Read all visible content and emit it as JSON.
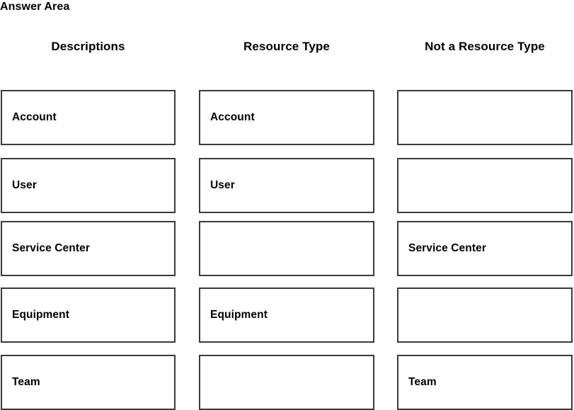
{
  "page": {
    "title": "Answer Area",
    "background_color": "#ffffff",
    "text_color": "#000000",
    "box_border_color": "#3a3a3a",
    "box_fill_color": "#ffffff"
  },
  "columns": [
    {
      "id": "descriptions",
      "header": "Descriptions"
    },
    {
      "id": "resource-type",
      "header": "Resource Type"
    },
    {
      "id": "not-a-resource-type",
      "header": "Not a Resource Type"
    }
  ],
  "rows": [
    {
      "id": "row-account",
      "cells": [
        {
          "column": "descriptions",
          "label": "Account",
          "empty": false
        },
        {
          "column": "resource-type",
          "label": "Account",
          "empty": false
        },
        {
          "column": "not-a-resource-type",
          "label": "",
          "empty": true
        }
      ]
    },
    {
      "id": "row-user",
      "cells": [
        {
          "column": "descriptions",
          "label": "User",
          "empty": false
        },
        {
          "column": "resource-type",
          "label": "User",
          "empty": false
        },
        {
          "column": "not-a-resource-type",
          "label": "",
          "empty": true
        }
      ]
    },
    {
      "id": "row-service-center",
      "cells": [
        {
          "column": "descriptions",
          "label": "Service Center",
          "empty": false
        },
        {
          "column": "resource-type",
          "label": "",
          "empty": true
        },
        {
          "column": "not-a-resource-type",
          "label": "Service Center",
          "empty": false
        }
      ]
    },
    {
      "id": "row-equipment",
      "cells": [
        {
          "column": "descriptions",
          "label": "Equipment",
          "empty": false
        },
        {
          "column": "resource-type",
          "label": "Equipment",
          "empty": false
        },
        {
          "column": "not-a-resource-type",
          "label": "",
          "empty": true
        }
      ]
    },
    {
      "id": "row-team",
      "cells": [
        {
          "column": "descriptions",
          "label": "Team",
          "empty": false
        },
        {
          "column": "resource-type",
          "label": "",
          "empty": true
        },
        {
          "column": "not-a-resource-type",
          "label": "Team",
          "empty": false
        }
      ]
    }
  ]
}
